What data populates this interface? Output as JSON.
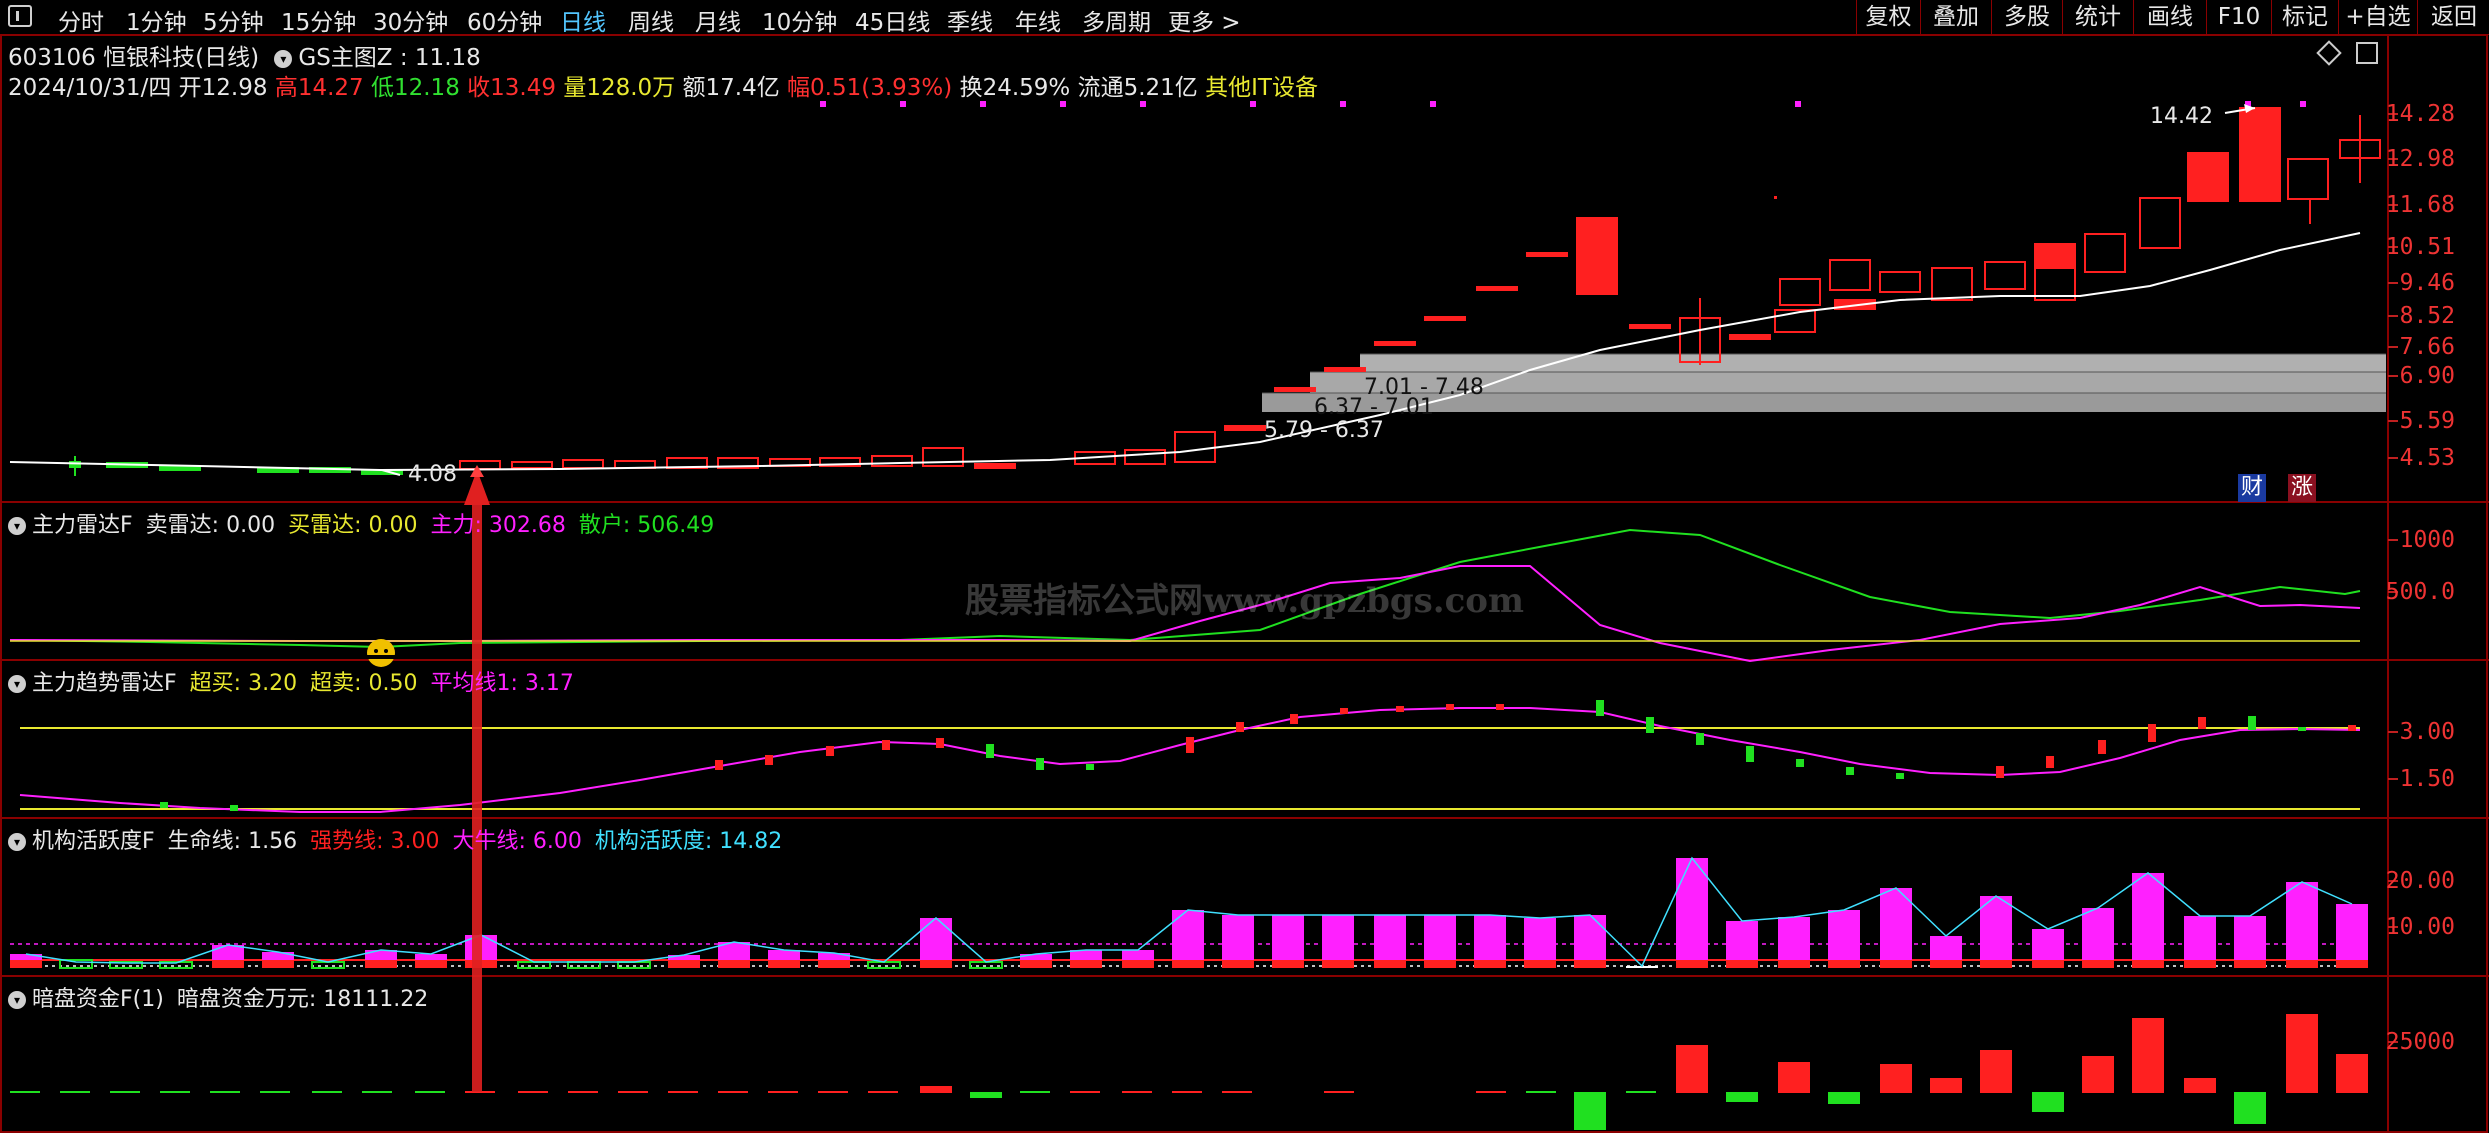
{
  "toolbar": {
    "periods": [
      "分时",
      "1分钟",
      "5分钟",
      "15分钟",
      "30分钟",
      "60分钟",
      "日线",
      "周线",
      "月线",
      "10分钟",
      "45日线",
      "季线",
      "年线",
      "多周期",
      "更多 >"
    ],
    "active_period": "日线",
    "right_tools": [
      "复权",
      "叠加",
      "多股",
      "统计",
      "画线",
      "F10",
      "标记",
      "+自选",
      "返回"
    ]
  },
  "stock": {
    "code_name": "603106 恒银科技(日线)",
    "main_indicator": "GS主图Z : 11.18",
    "date": "2024/10/31/四",
    "open_label": "开",
    "open": "12.98",
    "high_label": "高",
    "high": "14.27",
    "low_label": "低",
    "low": "12.18",
    "close_label": "收",
    "close": "13.49",
    "volume_label": "量",
    "volume": "128.0万",
    "amount_label": "额",
    "amount": "17.4亿",
    "change_label": "幅",
    "change": "0.51(3.93%)",
    "turnover_label": "换",
    "turnover": "24.59%",
    "float_label": "流通",
    "float_cap": "5.21亿",
    "sector": "其他IT设备"
  },
  "colors": {
    "up": "#ff2020",
    "down": "#20e020",
    "white": "#ffffff",
    "yellow": "#e8e830",
    "magenta": "#ff20ff",
    "cyan": "#40e0ff",
    "gray_band": "#9a9a9a",
    "active_tab": "#53c6ff",
    "border": "#8a0000"
  },
  "main_chart": {
    "price_axis": [
      "14.28",
      "12.98",
      "11.68",
      "10.51",
      "9.46",
      "8.52",
      "7.66",
      "6.90",
      "5.59",
      "4.53"
    ],
    "high_marker": "14.42",
    "low_marker": "4.08",
    "zones": [
      "7.01 - 7.48",
      "6.37 - 7.01",
      "5.79 - 6.37"
    ],
    "badges": [
      "财",
      "涨"
    ]
  },
  "panel1": {
    "name": "主力雷达F",
    "sell_label": "卖雷达:",
    "sell_value": "0.00",
    "buy_label": "买雷达:",
    "buy_value": "0.00",
    "main_label": "主力:",
    "main_value": "302.68",
    "retail_label": "散户:",
    "retail_value": "506.49",
    "axis": [
      "1000",
      "500.0"
    ]
  },
  "panel2": {
    "name": "主力趋势雷达F",
    "overbuy_label": "超买:",
    "overbuy_value": "3.20",
    "oversell_label": "超卖:",
    "oversell_value": "0.50",
    "avg_label": "平均线1:",
    "avg_value": "3.17",
    "axis": [
      "3.00",
      "1.50"
    ]
  },
  "panel3": {
    "name": "机构活跃度F",
    "life_label": "生命线:",
    "life_value": "1.56",
    "strong_label": "强势线:",
    "strong_value": "3.00",
    "bull_label": "大牛线:",
    "bull_value": "6.00",
    "active_label": "机构活跃度:",
    "active_value": "14.82",
    "axis": [
      "20.00",
      "10.00"
    ]
  },
  "panel4": {
    "name": "暗盘资金F(1)",
    "fund_label": "暗盘资金万元:",
    "fund_value": "18111.22",
    "axis": [
      "25000"
    ]
  },
  "watermark": "股票指标公式网www.gpzbgs.com"
}
